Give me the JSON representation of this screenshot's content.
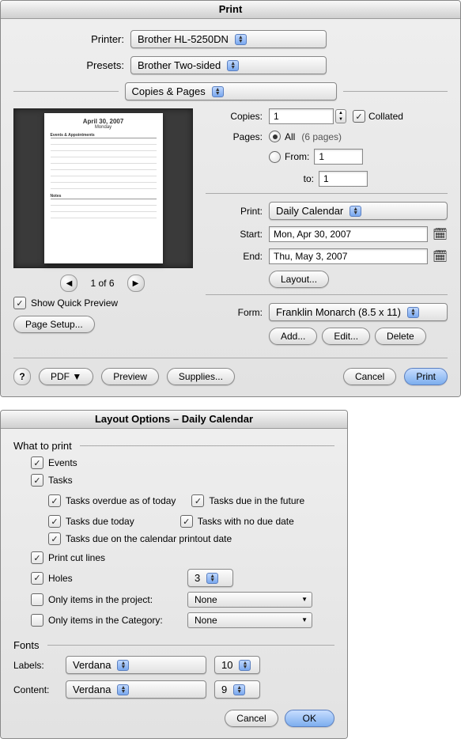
{
  "print": {
    "title": "Print",
    "printer_label": "Printer:",
    "printer_value": "Brother HL-5250DN",
    "presets_label": "Presets:",
    "presets_value": "Brother Two-sided",
    "section_value": "Copies & Pages",
    "copies_label": "Copies:",
    "copies_value": "1",
    "collated_label": "Collated",
    "pages_label": "Pages:",
    "pages_all": "All",
    "pages_count": "(6 pages)",
    "pages_from_label": "From:",
    "pages_from_value": "1",
    "pages_to_label": "to:",
    "pages_to_value": "1",
    "print_range_label": "Print:",
    "print_range_value": "Daily Calendar",
    "start_label": "Start:",
    "start_value": "Mon, Apr 30, 2007",
    "end_label": "End:",
    "end_value": "Thu, May 3, 2007",
    "layout_btn": "Layout...",
    "form_label": "Form:",
    "form_value": "Franklin Monarch (8.5 x 11)",
    "add_btn": "Add...",
    "edit_btn": "Edit...",
    "delete_btn": "Delete",
    "pager_text": "1 of 6",
    "show_preview": "Show Quick Preview",
    "page_setup": "Page Setup...",
    "pdf_btn": "PDF ▼",
    "preview_btn": "Preview",
    "supplies_btn": "Supplies...",
    "cancel_btn": "Cancel",
    "print_btn": "Print",
    "preview_title": "April 30, 2007",
    "preview_sub": "Monday"
  },
  "layout": {
    "title": "Layout Options – Daily Calendar",
    "what_label": "What to print",
    "events": "Events",
    "tasks": "Tasks",
    "t_overdue": "Tasks overdue as of today",
    "t_future": "Tasks due in the future",
    "t_today": "Tasks due today",
    "t_nodue": "Tasks with no due date",
    "t_printout": "Tasks due on the calendar printout date",
    "cutlines": "Print cut lines",
    "holes": "Holes",
    "holes_value": "3",
    "only_project": "Only items in the project:",
    "only_cat": "Only items in the Category:",
    "none": "None",
    "fonts_label": "Fonts",
    "labels": "Labels:",
    "content": "Content:",
    "font_labels_family": "Verdana",
    "font_labels_size": "10",
    "font_content_family": "Verdana",
    "font_content_size": "9",
    "cancel": "Cancel",
    "ok": "OK"
  }
}
